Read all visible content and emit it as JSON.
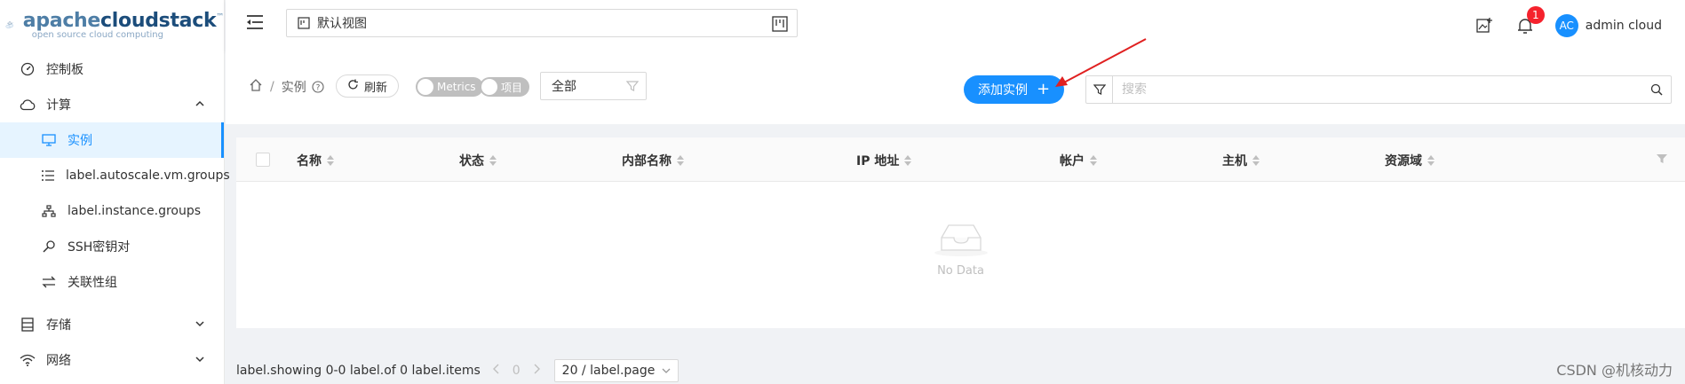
{
  "brand": {
    "name_light": "apache",
    "name_bold": "cloudstack",
    "tm": "™",
    "tagline": "open source cloud computing"
  },
  "sidebar": {
    "items": [
      {
        "label": "控制板",
        "icon": "dashboard-icon"
      },
      {
        "label": "计算",
        "icon": "cloud-icon",
        "expanded": true
      },
      {
        "label": "实例",
        "icon": "monitor-icon",
        "active": true
      },
      {
        "label": "label.autoscale.vm.groups",
        "icon": "list-icon"
      },
      {
        "label": "label.instance.groups",
        "icon": "sitemap-icon"
      },
      {
        "label": "SSH密钥对",
        "icon": "key-icon"
      },
      {
        "label": "关联性组",
        "icon": "swap-icon"
      },
      {
        "label": "存储",
        "icon": "database-icon"
      },
      {
        "label": "网络",
        "icon": "wifi-icon"
      }
    ]
  },
  "header": {
    "view_select": "默认视图",
    "notification_count": "1",
    "avatar_initials": "AC",
    "user_name": "admin cloud"
  },
  "toolbar": {
    "breadcrumb_current": "实例",
    "breadcrumb_sep": "/",
    "refresh_label": "刷新",
    "metrics_label": "Metrics",
    "project_label": "项目",
    "filter_value": "全部",
    "add_label": "添加实例",
    "add_plus": "+",
    "search_placeholder": "搜索"
  },
  "table": {
    "columns": [
      "名称",
      "状态",
      "内部名称",
      "IP 地址",
      "帐户",
      "主机",
      "资源域"
    ],
    "empty_text": "No Data"
  },
  "pagination": {
    "showing": "label.showing 0-0 label.of 0 label.items",
    "current_page": "0",
    "page_size": "20 / label.page"
  },
  "watermark": "CSDN @机核动力",
  "colors": {
    "primary": "#1890ff",
    "badge": "#f5222d",
    "annotation_arrow": "#e02020"
  }
}
